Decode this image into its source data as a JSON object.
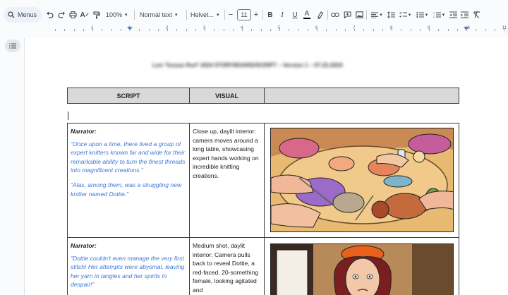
{
  "toolbar": {
    "menus_label": "Menus",
    "zoom": "100%",
    "style": "Normal text",
    "font": "Helvet...",
    "font_size": "11",
    "minus": "−",
    "plus": "+",
    "bold": "B",
    "italic": "I",
    "underline": "U",
    "text_color": "A"
  },
  "ruler": {
    "numbers": [
      "1",
      "1",
      "2",
      "3",
      "4",
      "5",
      "6",
      "7",
      "8",
      "9",
      "10",
      "11",
      "12",
      "13",
      "14",
      "15",
      "16",
      "17",
      "18"
    ]
  },
  "document": {
    "title_blurred": "Lorr Tossas Rurf' 2024 STORYBOARD/SCRIPT – Version 1 – 07.22.2024",
    "headers": {
      "script": "SCRIPT",
      "visual": "VISUAL",
      "third": ""
    },
    "rows": [
      {
        "narrator": "Narrator:",
        "quote1": "“Once upon a time, there lived a group of expert knitters known far and wide for their remarkable ability to turn the finest threads into magnificent creations.”",
        "quote2": "“Alas, among them, was a struggling new knitter named Dottie.”",
        "visual": "Close up, daylit interior: camera moves around a long table, showcasing expert hands working on incredible knitting creations."
      },
      {
        "narrator": "Narrator:",
        "quote1": "“Dottie couldn't even manage the very first stitch! Her attempts were abysmal, leaving her yarn in tangles and her spirits in despair!”",
        "visual": "Medium shot, daylit interior: Camera pulls back to reveal Dottie, a red-faced, 20-something female, looking agitated and"
      }
    ]
  },
  "colors": {
    "quote_blue": "#3c78d8",
    "header_gray": "#d9d9d9",
    "ruler_marker": "#4285f4"
  }
}
